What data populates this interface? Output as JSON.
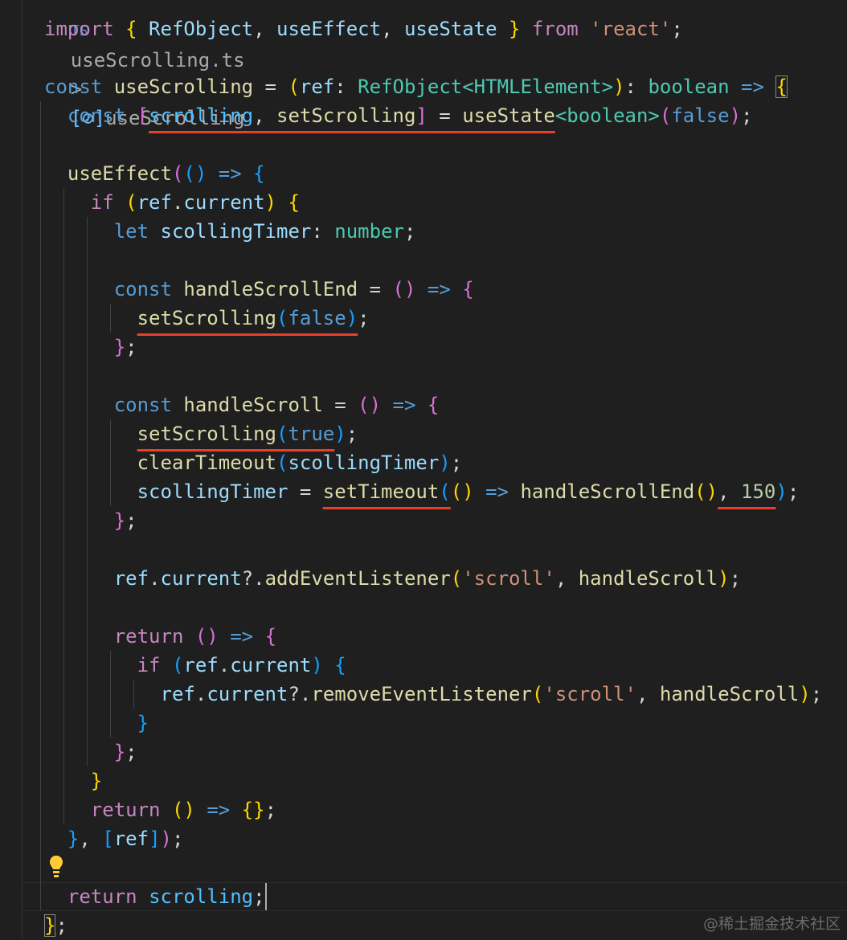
{
  "breadcrumb": {
    "file_icon": "ts-icon",
    "file_icon_text": "TS",
    "file": "useScrolling.ts",
    "separator": ">",
    "symbol_icon": "symbol-variable-icon",
    "symbol": "useScrolling"
  },
  "colors": {
    "background": "#1f1f1f",
    "underline": "#e8402a",
    "keyword": "#c586c0",
    "storage": "#569cd6",
    "function": "#dcdcaa",
    "variable": "#9cdcfe",
    "type": "#4ec9b0",
    "string": "#ce9178",
    "number": "#b5cea8"
  },
  "code_lines": [
    [
      [
        "import",
        "kw"
      ],
      [
        " ",
        "p"
      ],
      [
        "{",
        "b1"
      ],
      [
        " RefObject",
        "v"
      ],
      [
        ", ",
        "p"
      ],
      [
        "useEffect",
        "v"
      ],
      [
        ", ",
        "p"
      ],
      [
        "useState",
        "v"
      ],
      [
        " ",
        "p"
      ],
      [
        "}",
        "b1"
      ],
      [
        " ",
        "p"
      ],
      [
        "from",
        "kw"
      ],
      [
        " ",
        "p"
      ],
      [
        "'react'",
        "s"
      ],
      [
        ";",
        "p"
      ]
    ],
    [],
    [
      [
        "const",
        "st"
      ],
      [
        " ",
        "p"
      ],
      [
        "useScrolling",
        "fn"
      ],
      [
        " = ",
        "p"
      ],
      [
        "(",
        "b1"
      ],
      [
        "ref",
        "v"
      ],
      [
        ": ",
        "p"
      ],
      [
        "RefObject",
        "t"
      ],
      [
        "<",
        "t"
      ],
      [
        "HTMLElement",
        "t"
      ],
      [
        ">",
        "t"
      ],
      [
        ")",
        "b1"
      ],
      [
        ": ",
        "p"
      ],
      [
        "boolean",
        "t"
      ],
      [
        " ",
        "p"
      ],
      [
        "=>",
        "st"
      ],
      [
        " ",
        "p"
      ],
      [
        "{",
        "b1",
        "box"
      ]
    ],
    [
      [
        "  ",
        "p"
      ],
      [
        "const",
        "st"
      ],
      [
        " ",
        "p"
      ],
      [
        "[",
        "b2"
      ],
      [
        "scrolling",
        "c",
        "u"
      ],
      [
        ", ",
        "p",
        "u"
      ],
      [
        "setScrolling",
        "fn",
        "u"
      ],
      [
        "]",
        "b2",
        "u"
      ],
      [
        " = ",
        "p",
        "u"
      ],
      [
        "useState",
        "fn",
        "u"
      ],
      [
        "<",
        "t"
      ],
      [
        "boolean",
        "t"
      ],
      [
        ">",
        "t"
      ],
      [
        "(",
        "b2"
      ],
      [
        "false",
        "st"
      ],
      [
        ")",
        "b2"
      ],
      [
        ";",
        "p"
      ]
    ],
    [],
    [
      [
        "  ",
        "p"
      ],
      [
        "useEffect",
        "fn"
      ],
      [
        "(",
        "b2"
      ],
      [
        "()",
        "b3"
      ],
      [
        " ",
        "p"
      ],
      [
        "=>",
        "st"
      ],
      [
        " ",
        "p"
      ],
      [
        "{",
        "b3"
      ]
    ],
    [
      [
        "    ",
        "p"
      ],
      [
        "if",
        "kw"
      ],
      [
        " ",
        "p"
      ],
      [
        "(",
        "b1"
      ],
      [
        "ref",
        "v"
      ],
      [
        ".",
        "p"
      ],
      [
        "current",
        "v"
      ],
      [
        ")",
        "b1"
      ],
      [
        " ",
        "p"
      ],
      [
        "{",
        "b1"
      ]
    ],
    [
      [
        "      ",
        "p"
      ],
      [
        "let",
        "st"
      ],
      [
        " ",
        "p"
      ],
      [
        "scollingTimer",
        "v"
      ],
      [
        ": ",
        "p"
      ],
      [
        "number",
        "t"
      ],
      [
        ";",
        "p"
      ]
    ],
    [],
    [
      [
        "      ",
        "p"
      ],
      [
        "const",
        "st"
      ],
      [
        " ",
        "p"
      ],
      [
        "handleScrollEnd",
        "fn"
      ],
      [
        " = ",
        "p"
      ],
      [
        "()",
        "b2"
      ],
      [
        " ",
        "p"
      ],
      [
        "=>",
        "st"
      ],
      [
        " ",
        "p"
      ],
      [
        "{",
        "b2"
      ]
    ],
    [
      [
        "        ",
        "p"
      ],
      [
        "setScrolling",
        "fn",
        "u"
      ],
      [
        "(",
        "b3",
        "u"
      ],
      [
        "false",
        "st",
        "u"
      ],
      [
        ")",
        "b3",
        "u"
      ],
      [
        ";",
        "p"
      ]
    ],
    [
      [
        "      ",
        "p"
      ],
      [
        "}",
        "b2"
      ],
      [
        ";",
        "p"
      ]
    ],
    [],
    [
      [
        "      ",
        "p"
      ],
      [
        "const",
        "st"
      ],
      [
        " ",
        "p"
      ],
      [
        "handleScroll",
        "fn"
      ],
      [
        " = ",
        "p"
      ],
      [
        "()",
        "b2"
      ],
      [
        " ",
        "p"
      ],
      [
        "=>",
        "st"
      ],
      [
        " ",
        "p"
      ],
      [
        "{",
        "b2"
      ]
    ],
    [
      [
        "        ",
        "p"
      ],
      [
        "setScrolling",
        "fn",
        "u"
      ],
      [
        "(",
        "b3",
        "u"
      ],
      [
        "true",
        "st",
        "u"
      ],
      [
        ")",
        "b3"
      ],
      [
        ";",
        "p"
      ]
    ],
    [
      [
        "        ",
        "p"
      ],
      [
        "clearTimeout",
        "fn"
      ],
      [
        "(",
        "b3"
      ],
      [
        "scollingTimer",
        "v"
      ],
      [
        ")",
        "b3"
      ],
      [
        ";",
        "p"
      ]
    ],
    [
      [
        "        ",
        "p"
      ],
      [
        "scollingTimer",
        "v"
      ],
      [
        " = ",
        "p"
      ],
      [
        "setTimeout",
        "fn",
        "u"
      ],
      [
        "(",
        "b3",
        "u"
      ],
      [
        "()",
        "b1"
      ],
      [
        " ",
        "p"
      ],
      [
        "=>",
        "st"
      ],
      [
        " ",
        "p"
      ],
      [
        "handleScrollEnd",
        "fn"
      ],
      [
        "()",
        "b1"
      ],
      [
        ", ",
        "p",
        "u"
      ],
      [
        "150",
        "n",
        "u"
      ],
      [
        ")",
        "b3"
      ],
      [
        ";",
        "p"
      ]
    ],
    [
      [
        "      ",
        "p"
      ],
      [
        "}",
        "b2"
      ],
      [
        ";",
        "p"
      ]
    ],
    [],
    [
      [
        "      ",
        "p"
      ],
      [
        "ref",
        "v"
      ],
      [
        ".",
        "p"
      ],
      [
        "current",
        "v"
      ],
      [
        "?.",
        "p"
      ],
      [
        "addEventListener",
        "fn"
      ],
      [
        "(",
        "b1"
      ],
      [
        "'scroll'",
        "s"
      ],
      [
        ", ",
        "p"
      ],
      [
        "handleScroll",
        "fn"
      ],
      [
        ")",
        "b1"
      ],
      [
        ";",
        "p"
      ]
    ],
    [],
    [
      [
        "      ",
        "p"
      ],
      [
        "return",
        "kw"
      ],
      [
        " ",
        "p"
      ],
      [
        "()",
        "b2"
      ],
      [
        " ",
        "p"
      ],
      [
        "=>",
        "st"
      ],
      [
        " ",
        "p"
      ],
      [
        "{",
        "b2"
      ]
    ],
    [
      [
        "        ",
        "p"
      ],
      [
        "if",
        "kw"
      ],
      [
        " ",
        "p"
      ],
      [
        "(",
        "b3"
      ],
      [
        "ref",
        "v"
      ],
      [
        ".",
        "p"
      ],
      [
        "current",
        "v"
      ],
      [
        ")",
        "b3"
      ],
      [
        " ",
        "p"
      ],
      [
        "{",
        "b3"
      ]
    ],
    [
      [
        "          ",
        "p"
      ],
      [
        "ref",
        "v"
      ],
      [
        ".",
        "p"
      ],
      [
        "current",
        "v"
      ],
      [
        "?.",
        "p"
      ],
      [
        "removeEventListener",
        "fn"
      ],
      [
        "(",
        "b1"
      ],
      [
        "'scroll'",
        "s"
      ],
      [
        ", ",
        "p"
      ],
      [
        "handleScroll",
        "fn"
      ],
      [
        ")",
        "b1"
      ],
      [
        ";",
        "p"
      ]
    ],
    [
      [
        "        ",
        "p"
      ],
      [
        "}",
        "b3"
      ]
    ],
    [
      [
        "      ",
        "p"
      ],
      [
        "}",
        "b2"
      ],
      [
        ";",
        "p"
      ]
    ],
    [
      [
        "    ",
        "p"
      ],
      [
        "}",
        "b1"
      ]
    ],
    [
      [
        "    ",
        "p"
      ],
      [
        "return",
        "kw"
      ],
      [
        " ",
        "p"
      ],
      [
        "()",
        "b1"
      ],
      [
        " ",
        "p"
      ],
      [
        "=>",
        "st"
      ],
      [
        " ",
        "p"
      ],
      [
        "{}",
        "b1"
      ],
      [
        ";",
        "p"
      ]
    ],
    [
      [
        "  ",
        "p"
      ],
      [
        "}",
        "b3"
      ],
      [
        ", ",
        "p"
      ],
      [
        "[",
        "b3"
      ],
      [
        "ref",
        "v"
      ],
      [
        "]",
        "b3"
      ],
      [
        ")",
        "b2"
      ],
      [
        ";",
        "p"
      ]
    ],
    [],
    [
      [
        "  ",
        "p"
      ],
      [
        "return",
        "kw"
      ],
      [
        " ",
        "p"
      ],
      [
        "scrolling",
        "c"
      ],
      [
        ";",
        "p"
      ]
    ],
    [
      [
        "}",
        "b1",
        "box"
      ],
      [
        ";",
        "p"
      ]
    ]
  ],
  "current_line_index": 30,
  "lightbulb_line_index": 29,
  "lightbulb_icon": "lightbulb-icon",
  "watermark": "@稀土掘金技术社区"
}
